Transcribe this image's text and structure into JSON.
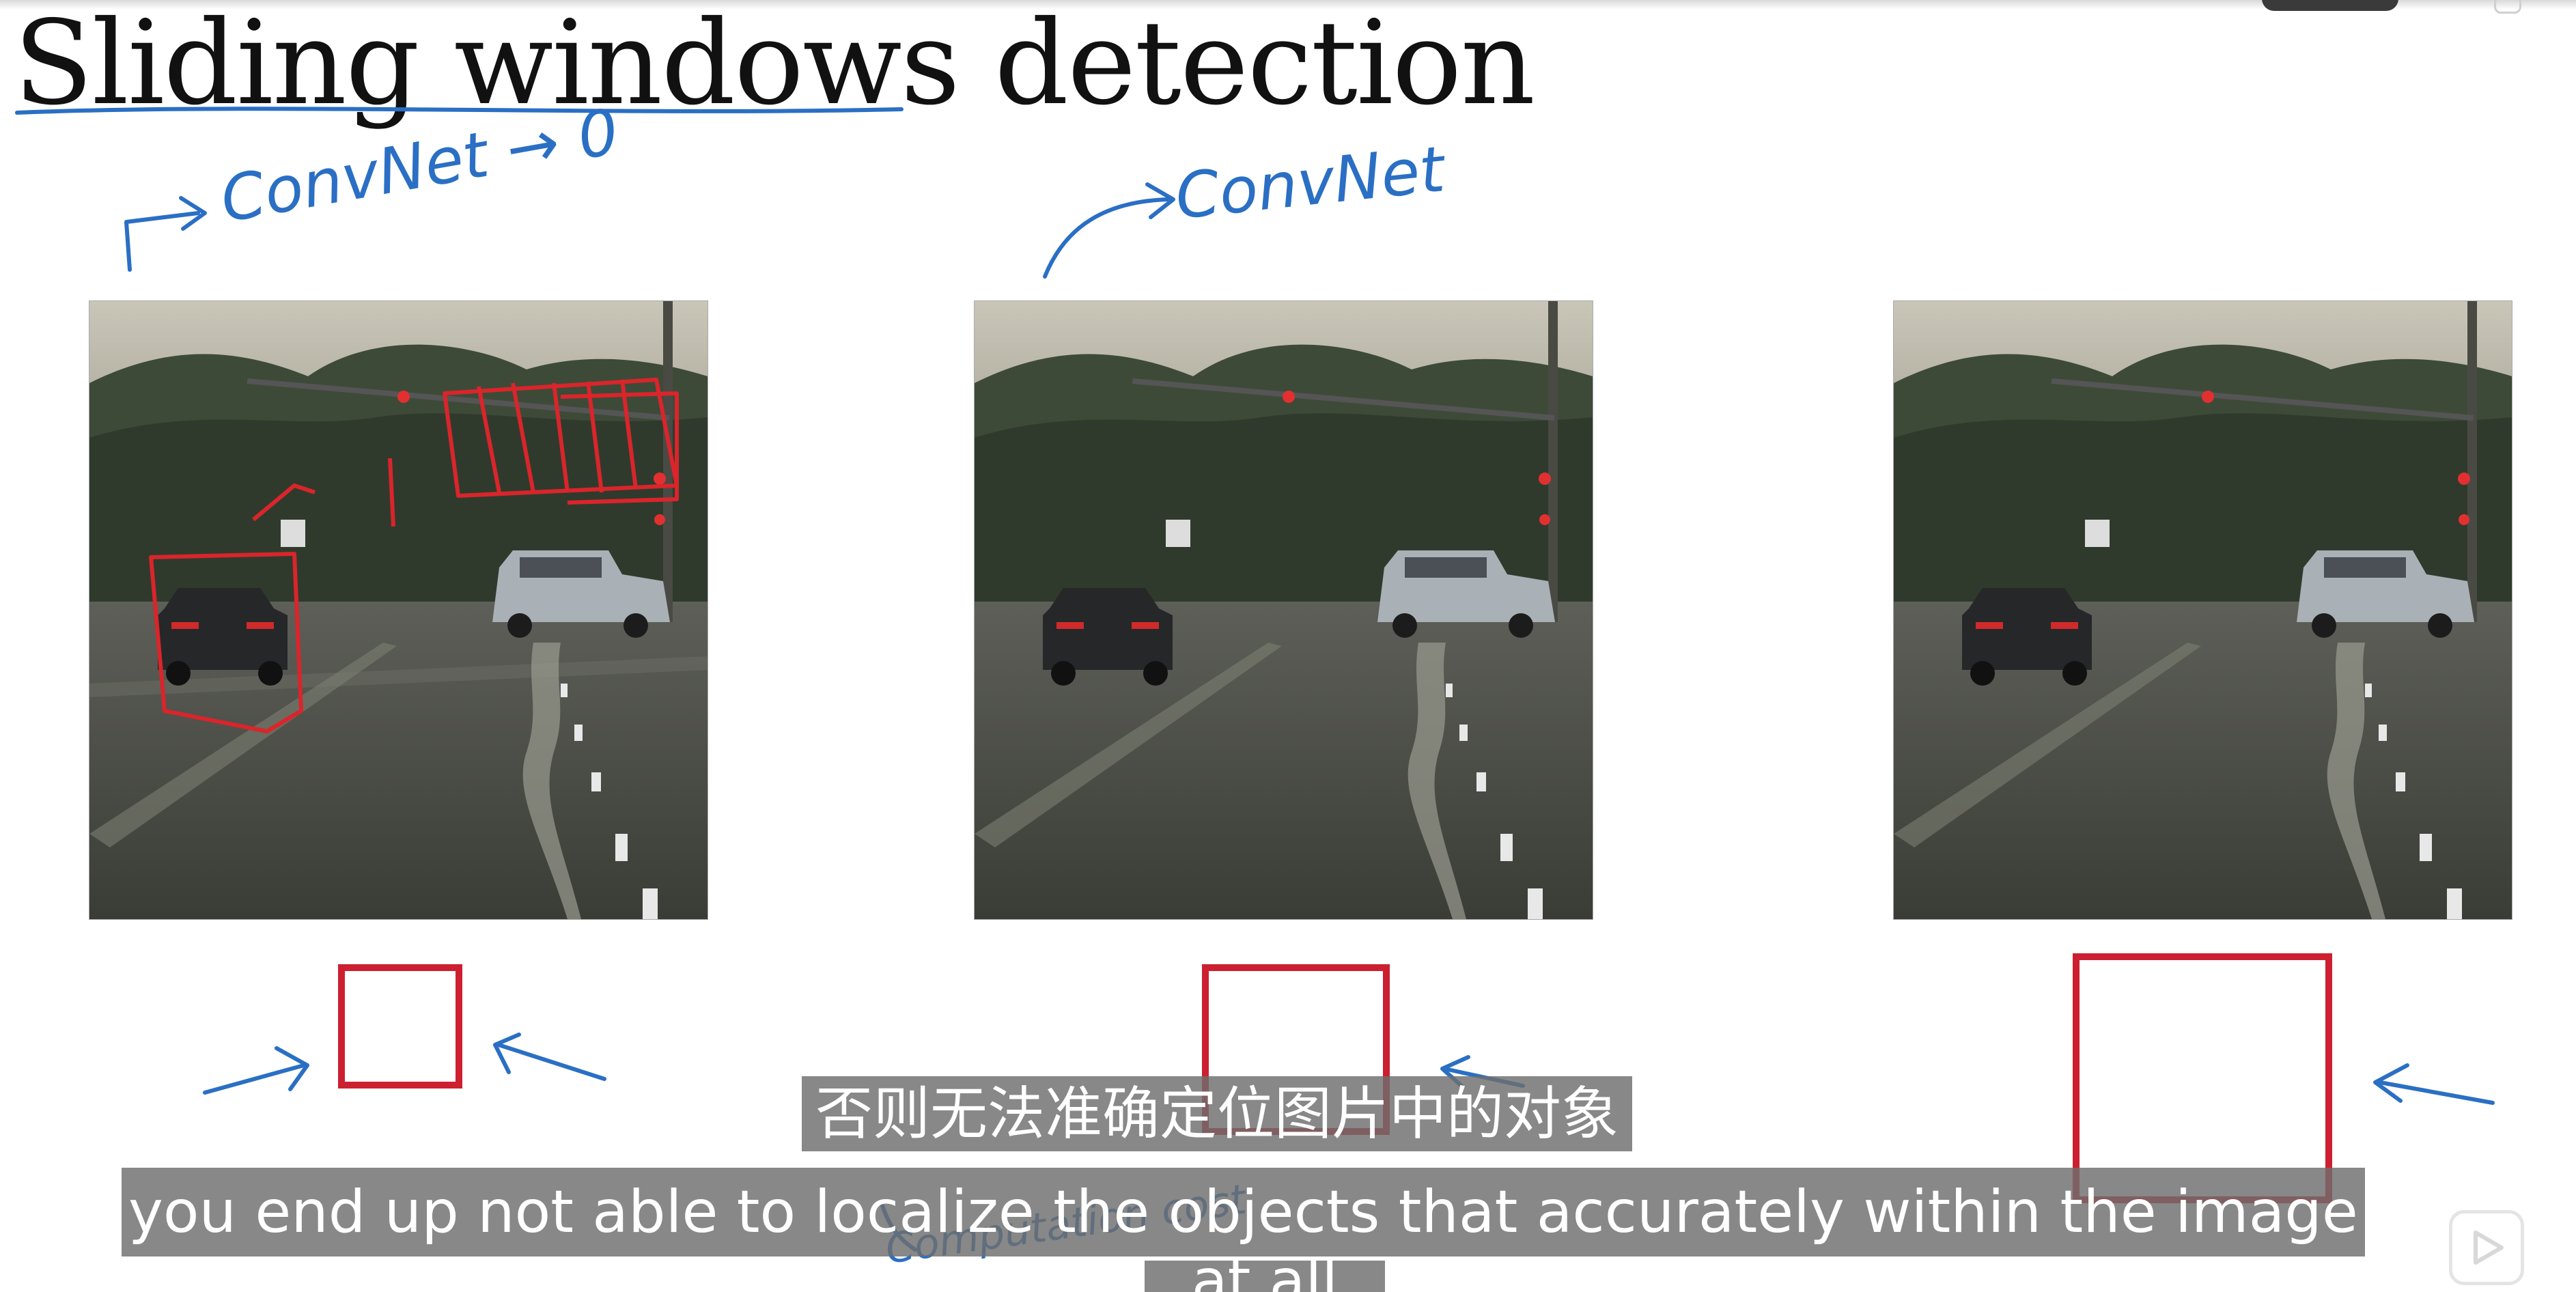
{
  "slide": {
    "title": "Sliding windows detection"
  },
  "subtitles": {
    "chinese": "否则无法准确定位图片中的对象",
    "english": "you end up not able to localize the objects that accurately within the image",
    "english_next_partial": "at all"
  },
  "handwriting": {
    "annotation_1": "ConvNet → 0",
    "annotation_2": "ConvNet",
    "annotation_3": "Computation cost",
    "ink_color": "#2a6fc4",
    "window_color": "#cc2030"
  },
  "scenes": [
    {
      "name": "road-scene-1",
      "has_sliding_window_marks": true
    },
    {
      "name": "road-scene-2",
      "has_sliding_window_marks": false
    },
    {
      "name": "road-scene-3",
      "has_sliding_window_marks": false
    }
  ],
  "window_sizes": [
    "small",
    "medium",
    "large"
  ],
  "controls": {
    "play_icon": "play-icon"
  }
}
